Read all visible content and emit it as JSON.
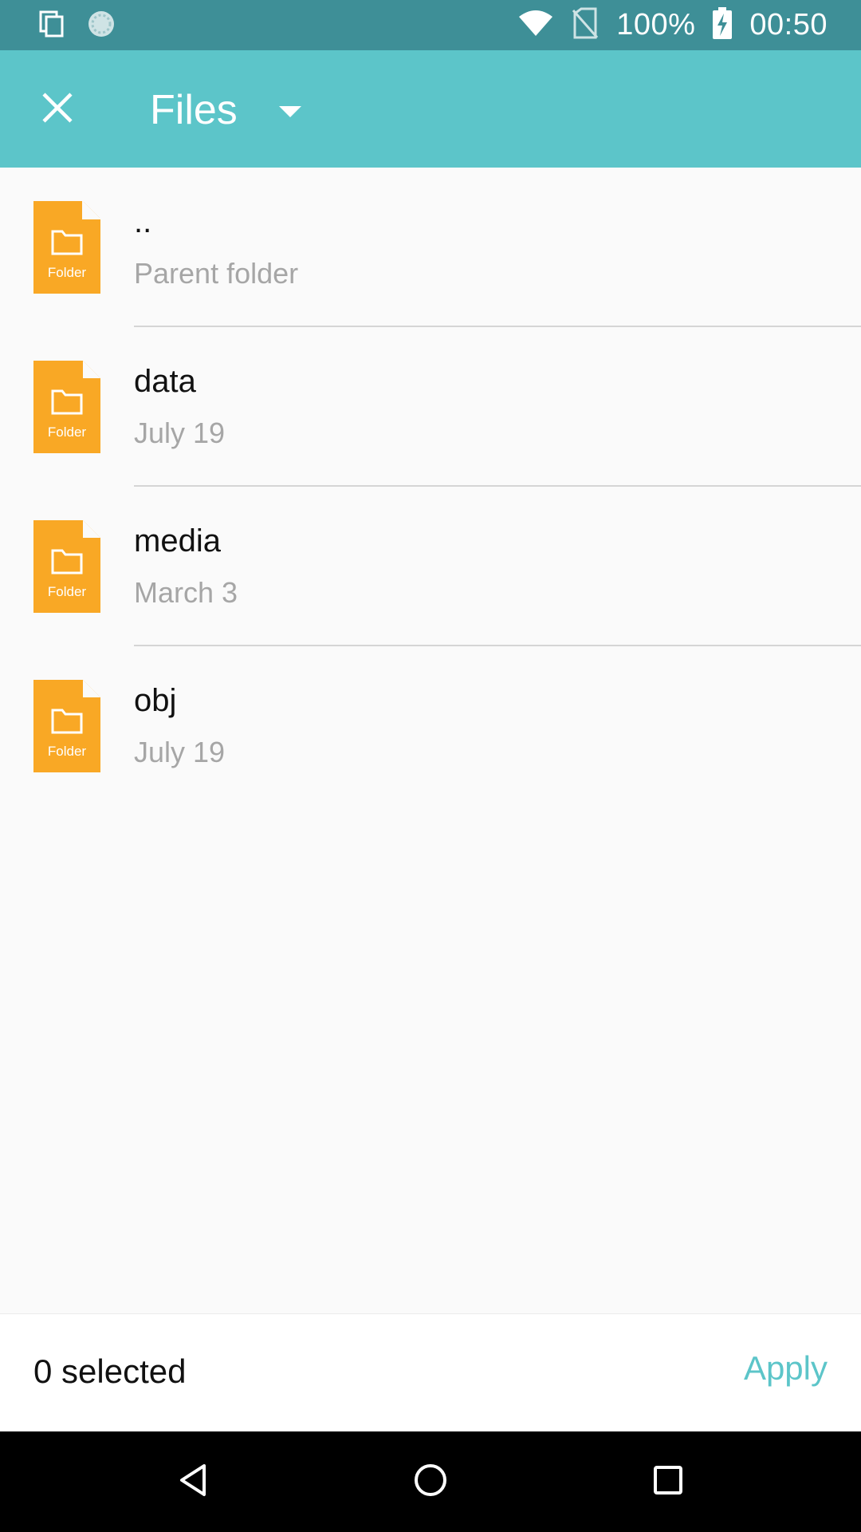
{
  "status_bar": {
    "battery_percent": "100%",
    "time": "00:50",
    "icons": [
      "copy-icon",
      "sync-icon",
      "wifi-icon",
      "no-sim-icon",
      "battery-charging-icon"
    ]
  },
  "app_bar": {
    "title": "Files",
    "close_icon": "close-icon",
    "dropdown_icon": "caret-down-icon"
  },
  "files": [
    {
      "name": "..",
      "meta": "Parent folder",
      "icon_label": "Folder"
    },
    {
      "name": "data",
      "meta": "July 19",
      "icon_label": "Folder"
    },
    {
      "name": "media",
      "meta": "March 3",
      "icon_label": "Folder"
    },
    {
      "name": "obj",
      "meta": "July 19",
      "icon_label": "Folder"
    }
  ],
  "action_bar": {
    "selected_text": "0 selected",
    "apply_label": "Apply"
  },
  "nav_bar": {
    "icons": [
      "back-icon",
      "home-icon",
      "recents-icon"
    ]
  },
  "colors": {
    "status_bar": "#3e8f97",
    "app_bar": "#5cc5c9",
    "folder_icon": "#f9a825",
    "accent": "#5cc5c9"
  }
}
